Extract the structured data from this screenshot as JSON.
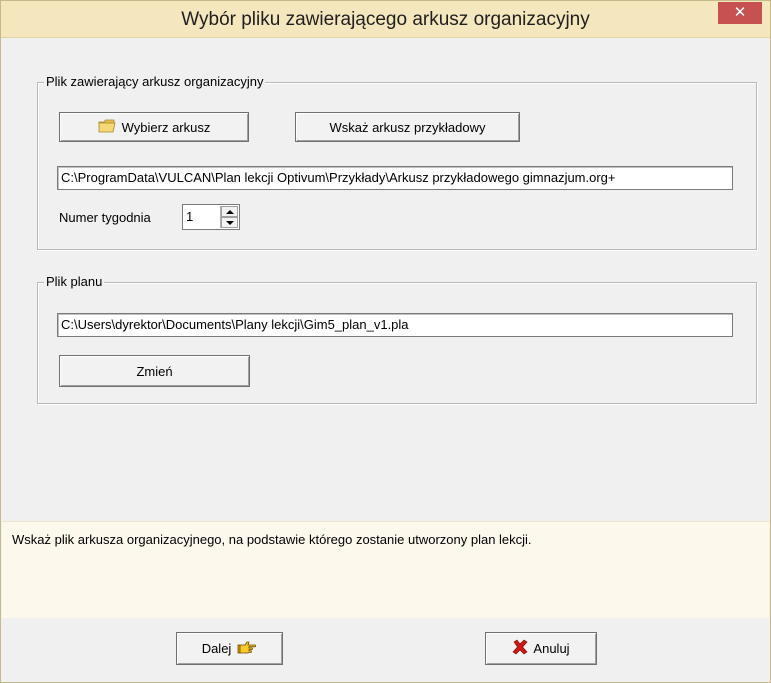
{
  "window": {
    "title": "Wybór pliku zawierającego arkusz organizacyjny",
    "close_glyph": "✕"
  },
  "sheet_group": {
    "legend": "Plik zawierający arkusz organizacyjny",
    "choose_label": "Wybierz arkusz",
    "sample_label": "Wskaż arkusz przykładowy",
    "path_value": "C:\\ProgramData\\VULCAN\\Plan lekcji Optivum\\Przykłady\\Arkusz przykładowego gimnazjum.org+",
    "week_label": "Numer tygodnia",
    "week_value": "1"
  },
  "plan_group": {
    "legend": "Plik planu",
    "path_value": "C:\\Users\\dyrektor\\Documents\\Plany lekcji\\Gim5_plan_v1.pla",
    "change_label": "Zmień"
  },
  "hint": {
    "text": "Wskaż plik arkusza organizacyjnego,  na podstawie którego zostanie utworzony plan lekcji."
  },
  "footer": {
    "next_label": "Dalej",
    "cancel_label": "Anuluj"
  },
  "icons": {
    "folder": "folder-icon",
    "pointing_hand": "pointing-hand-icon",
    "cancel_x": "red-x-icon"
  },
  "colors": {
    "titlebar": "#f4e6bd",
    "close": "#c75050",
    "hint_bg": "#fdf8ec",
    "dialog_bg": "#f0f0f0"
  }
}
